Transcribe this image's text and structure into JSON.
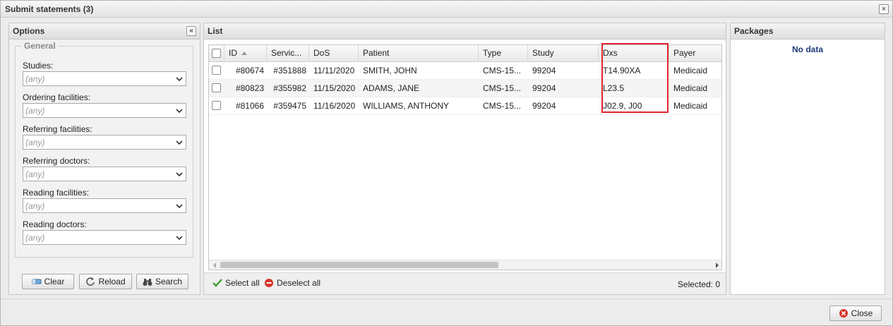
{
  "window": {
    "title": "Submit statements (3)",
    "close_glyph": "×"
  },
  "options": {
    "title": "Options",
    "collapse_glyph": "«",
    "general_legend": "General",
    "fields": [
      {
        "label": "Studies:",
        "value": "(any)"
      },
      {
        "label": "Ordering facilities:",
        "value": "(any)"
      },
      {
        "label": "Referring facilities:",
        "value": "(any)"
      },
      {
        "label": "Referring doctors:",
        "value": "(any)"
      },
      {
        "label": "Reading facilities:",
        "value": "(any)"
      },
      {
        "label": "Reading doctors:",
        "value": "(any)"
      }
    ],
    "buttons": {
      "clear": "Clear",
      "reload": "Reload",
      "search": "Search"
    }
  },
  "list": {
    "title": "List",
    "columns": [
      "ID",
      "Servic...",
      "DoS",
      "Patient",
      "Type",
      "Study",
      "Dxs",
      "Payer"
    ],
    "sort_column": "ID",
    "rows": [
      {
        "id": "#80674",
        "service": "#351888",
        "dos": "11/11/2020",
        "patient": "SMITH, JOHN",
        "type": "CMS-15...",
        "study": "99204",
        "dxs": "T14.90XA",
        "payer": "Medicaid"
      },
      {
        "id": "#80823",
        "service": "#355982",
        "dos": "11/15/2020",
        "patient": "ADAMS, JANE",
        "type": "CMS-15...",
        "study": "99204",
        "dxs": "L23.5",
        "payer": "Medicaid"
      },
      {
        "id": "#81066",
        "service": "#359475",
        "dos": "11/16/2020",
        "patient": "WILLIAMS, ANTHONY",
        "type": "CMS-15...",
        "study": "99204",
        "dxs": "J02.9, J00",
        "payer": "Medicaid"
      }
    ],
    "select_all": "Select all",
    "deselect_all": "Deselect all",
    "selected_label": "Selected:",
    "selected_count": "0",
    "highlight_color": "#e0262c"
  },
  "packages": {
    "title": "Packages",
    "empty_text": "No data"
  },
  "footer": {
    "close_label": "Close"
  },
  "colors": {
    "accent_nodata": "#1f3a7a",
    "select_all_icon": "#3a9a2a",
    "deselect_icon": "#d9332b",
    "close_icon": "#d9332b"
  }
}
